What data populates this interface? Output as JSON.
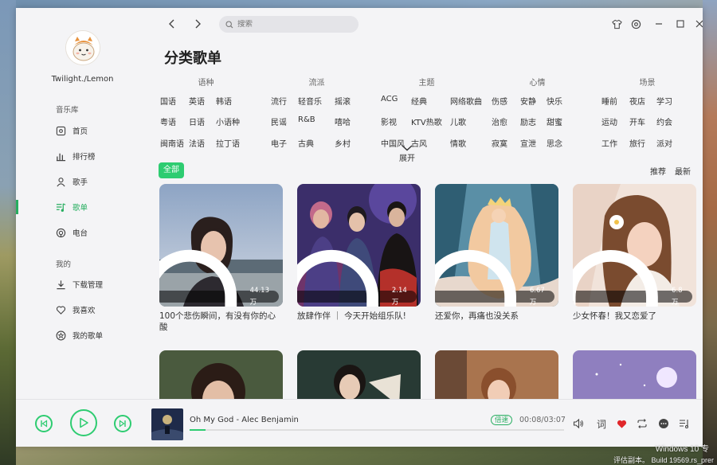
{
  "app": {
    "user": {
      "name": "Twilight./Lemon"
    },
    "search": {
      "placeholder": "搜索"
    },
    "sidebar": {
      "sections": [
        {
          "title": "音乐库",
          "items": [
            "首页",
            "排行榜",
            "歌手",
            "歌单",
            "电台"
          ]
        },
        {
          "title": "我的",
          "items": [
            "下载管理",
            "我喜欢",
            "我的歌单"
          ]
        }
      ],
      "active_item": "歌单"
    },
    "page_title": "分类歌单",
    "categories": [
      {
        "head": "语种",
        "tags": [
          "国语",
          "英语",
          "韩语",
          "粤语",
          "日语",
          "小语种",
          "闽南语",
          "法语",
          "拉丁语"
        ]
      },
      {
        "head": "流派",
        "tags": [
          "流行",
          "轻音乐",
          "摇滚",
          "民谣",
          "R&B",
          "嘻哈",
          "电子",
          "古典",
          "乡村"
        ]
      },
      {
        "head": "主题",
        "tags": [
          "ACG",
          "经典",
          "网络歌曲",
          "影视",
          "KTV热歌",
          "儿歌",
          "中国风",
          "古风",
          "情歌"
        ]
      },
      {
        "head": "心情",
        "tags": [
          "伤感",
          "安静",
          "快乐",
          "治愈",
          "励志",
          "甜蜜",
          "寂寞",
          "宣泄",
          "思念"
        ]
      },
      {
        "head": "场景",
        "tags": [
          "睡前",
          "夜店",
          "学习",
          "运动",
          "开车",
          "约会",
          "工作",
          "旅行",
          "派对"
        ]
      }
    ],
    "expand_label": "展开",
    "filter_all": "全部",
    "sort": {
      "recommend": "推荐",
      "newest": "最新"
    },
    "playlists": [
      {
        "title": "100个悲伤瞬间，有没有你的心酸",
        "count": "44.13万"
      },
      {
        "title": "放肆作伴 ｜ 今天开始组乐队!",
        "count": "2.14万"
      },
      {
        "title": "还爱你，再痛也没关系",
        "count": "6.67万"
      },
      {
        "title": "少女怀春！我又恋爱了",
        "count": "6.8万"
      },
      {
        "title": "",
        "count": ""
      },
      {
        "title": "",
        "count": ""
      },
      {
        "title": "",
        "count": ""
      },
      {
        "title": "",
        "count": ""
      }
    ],
    "player": {
      "song": "Oh My God - Alec Benjamin",
      "quality": "倍速",
      "time": "00:08/03:07",
      "progress": 0.043,
      "lyric_label": "词"
    },
    "colors": {
      "accent": "#2ecc71",
      "heart": "#e0262a"
    }
  },
  "os": {
    "line1": "Windows 10 专",
    "line2": "评估副本。 Build 19569.rs_prer"
  }
}
